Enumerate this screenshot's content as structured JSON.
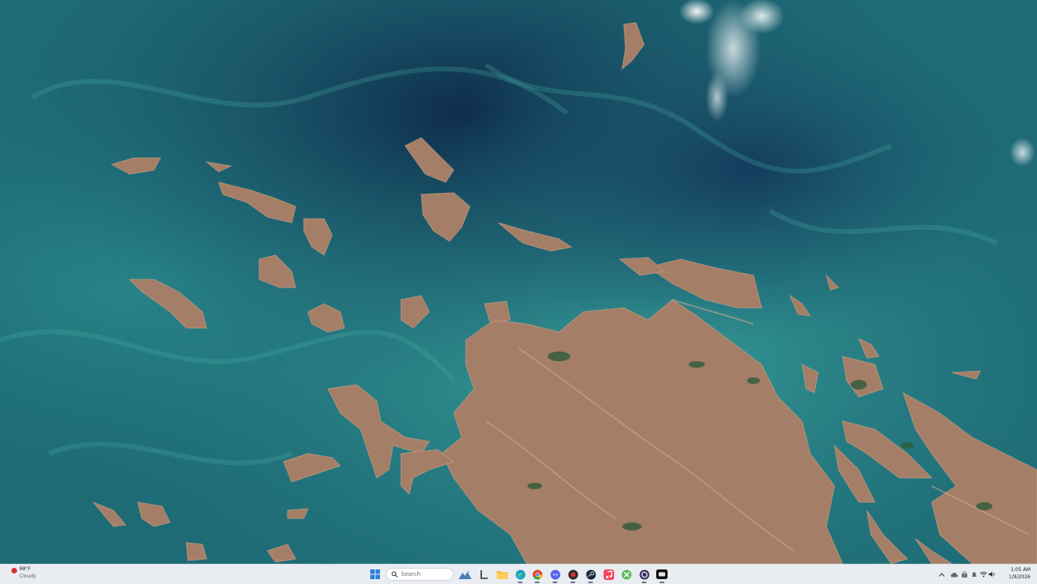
{
  "desktop": {
    "wallpaper_description": ""
  },
  "weather_widget": {
    "temperature": "68°F",
    "condition": "Cloudy",
    "icon": "weather-alert-icon"
  },
  "taskbar": {
    "search": {
      "placeholder": "Search",
      "value": ""
    },
    "apps": [
      {
        "name": "start-button",
        "icon": "windows-logo-icon"
      },
      {
        "name": "search-box",
        "icon": "search-icon"
      },
      {
        "name": "widgets-app",
        "icon": "landscape-icon"
      },
      {
        "name": "terminal-app",
        "icon": "terminal-icon"
      },
      {
        "name": "file-explorer-app",
        "icon": "folder-icon"
      },
      {
        "name": "edge-app",
        "icon": "edge-icon"
      },
      {
        "name": "chrome-app",
        "icon": "chrome-icon"
      },
      {
        "name": "discord-app",
        "icon": "discord-icon"
      },
      {
        "name": "media-app",
        "icon": "media-icon"
      },
      {
        "name": "steam-app",
        "icon": "steam-icon"
      },
      {
        "name": "music-app",
        "icon": "music-icon"
      },
      {
        "name": "xbox-app",
        "icon": "xbox-icon"
      },
      {
        "name": "obs-app",
        "icon": "obs-icon"
      },
      {
        "name": "tv-app",
        "icon": "tv-icon"
      }
    ]
  },
  "tray": {
    "time": "1:05 AM",
    "date": "1/9/2026"
  },
  "colors": {
    "ocean_deep": "#0f2f4f",
    "ocean_mid": "#1f6f79",
    "ocean_shallow": "#3fa7a2",
    "land": "#a47e66",
    "land_highlight": "#c79c80",
    "vegetation": "#2e5a3a",
    "taskbar_bg": "#e9edf2"
  }
}
